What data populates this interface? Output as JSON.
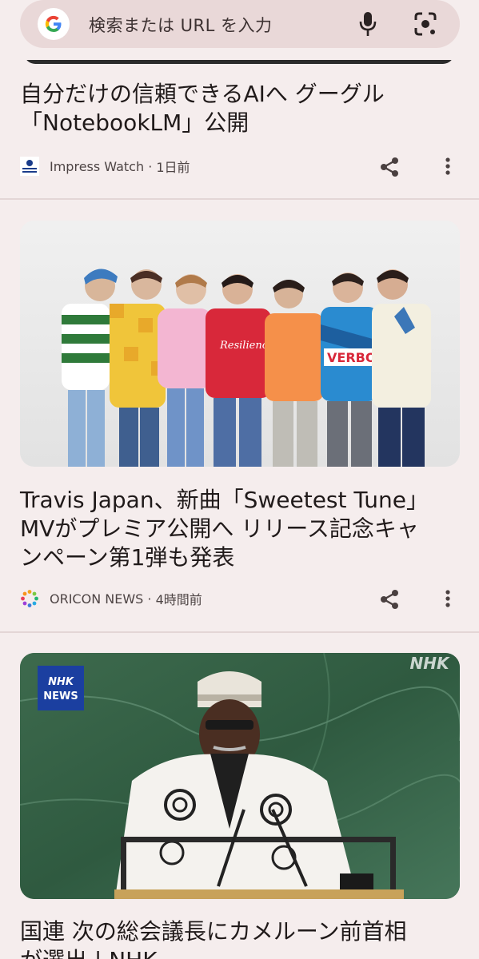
{
  "search": {
    "placeholder": "検索または URL を入力"
  },
  "articles": [
    {
      "headline_line1": "自分だけの信頼できるAIへ グーグル",
      "headline_line2": "「NotebookLM」公開",
      "source": "Impress Watch",
      "time": "1日前",
      "logo_text": "Impress Watch"
    },
    {
      "headline_line1": "Travis Japan、新曲「Sweetest Tune」",
      "headline_line2": "MVがプレミア公開へ リリース記念キャ",
      "headline_line3": "ンペーン第1弾も発表",
      "source": "ORICON NEWS",
      "time": "4時間前",
      "shirt_text_1": "Resilience",
      "shirt_text_2": "VERBO"
    },
    {
      "headline_line1": "国連 次の総会議長にカメルーン前首相",
      "headline_line2": "が選出 | NHK",
      "watermark": "NHK",
      "badge_line1": "NHK",
      "badge_line2": "NEWS"
    }
  ],
  "icons": [
    "google-logo-icon",
    "mic-icon",
    "lens-icon",
    "share-icon",
    "more-vert-icon"
  ],
  "colors": {
    "background": "#f5eded",
    "searchbar": "#e9d8d8",
    "nhk_badge": "#1b3fa0"
  }
}
